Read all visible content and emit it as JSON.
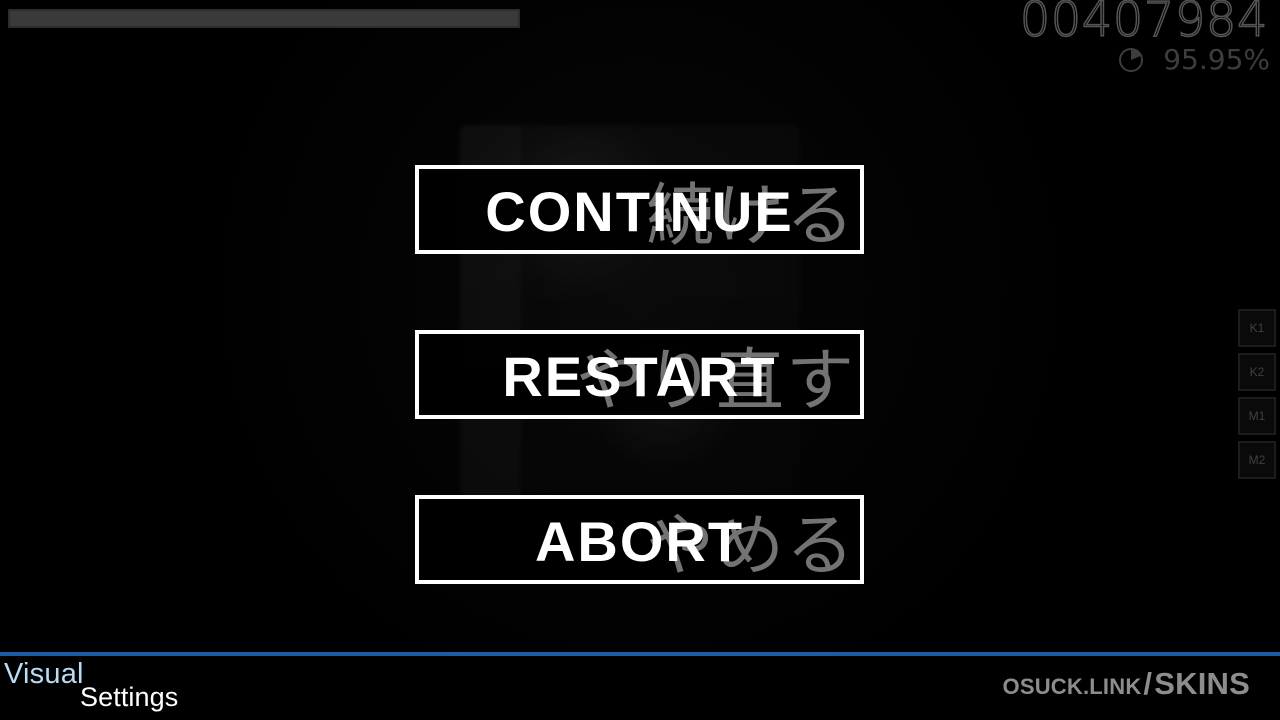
{
  "hud": {
    "score": "00407984",
    "accuracy": "95.95%",
    "accuracy_icon": "pie-clock-icon",
    "progress_fraction": 1
  },
  "pause_menu": {
    "buttons": [
      {
        "label": "CONTINUE",
        "ghost_label": "続ける"
      },
      {
        "label": "RESTART",
        "ghost_label": "やり直す"
      },
      {
        "label": "ABORT",
        "ghost_label": "やめる"
      }
    ]
  },
  "key_overlay": {
    "keys": [
      "K1",
      "K2",
      "M1",
      "M2"
    ]
  },
  "bottom_bar": {
    "visual": "Visual",
    "settings": "Settings",
    "link_main": "OSUCK.LINK",
    "link_slash": "/",
    "link_tail": "SKINS"
  },
  "colors": {
    "background": "#000000",
    "button_border": "#ffffff",
    "bottom_line": "#1f5ca8",
    "hud_text": "#555555"
  }
}
